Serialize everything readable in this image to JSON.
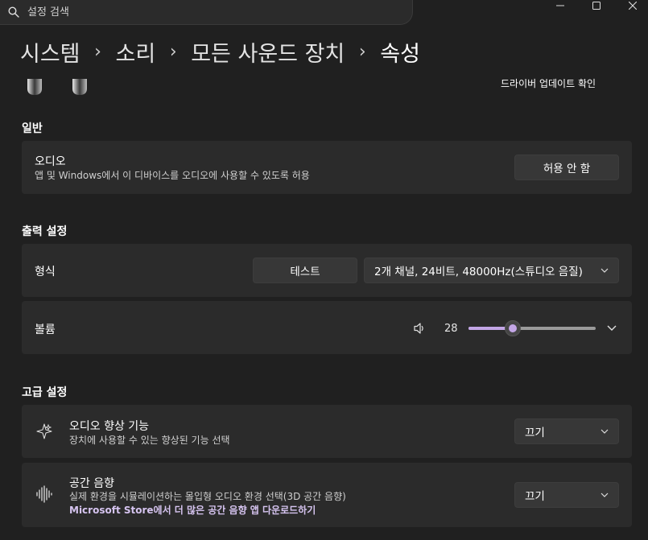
{
  "search": {
    "placeholder": "설정 검색"
  },
  "window_controls": {
    "minimize": "—",
    "maximize": "☐",
    "close": "✕"
  },
  "breadcrumb": {
    "items": [
      "시스템",
      "소리",
      "모든 사운드 장치",
      "속성"
    ],
    "separator": "›"
  },
  "device": {
    "driver_update_link": "드라이버 업데이트 확인"
  },
  "general": {
    "title": "일반",
    "audio": {
      "title": "오디오",
      "description": "앱 및 Windows에서 이 디바이스를 오디오에 사용할 수 있도록 허용",
      "button_label": "허용 안 함"
    }
  },
  "output": {
    "title": "출력 설정",
    "format": {
      "title": "형식",
      "test_button": "테스트",
      "selected_value": "2개 채널, 24비트, 48000Hz(스튜디오 음질)"
    },
    "volume": {
      "title": "볼륨",
      "value_label": "28",
      "level": 28
    }
  },
  "advanced": {
    "title": "고급 설정",
    "enhancement": {
      "title": "오디오 향상 기능",
      "description": "장치에 사용할 수 있는 향상된 기능 선택",
      "selected_value": "끄기"
    },
    "spatial": {
      "title": "공간 음향",
      "description": "실제 환경을 시뮬레이션하는 몰입형 오디오 환경 선택(3D 공간 음향)",
      "store_link": "Microsoft Store에서 더 많은 공간 음향 앱 다운로드하기",
      "selected_value": "끄기"
    }
  },
  "colors": {
    "background": "#202020",
    "card": "#2b2b2b",
    "accent": "#c3a6e6",
    "link": "#d6c4f0"
  },
  "icons": [
    "search-icon",
    "speaker-icon",
    "chevron-down-icon",
    "sparkle-icon",
    "sound-wave-icon"
  ]
}
